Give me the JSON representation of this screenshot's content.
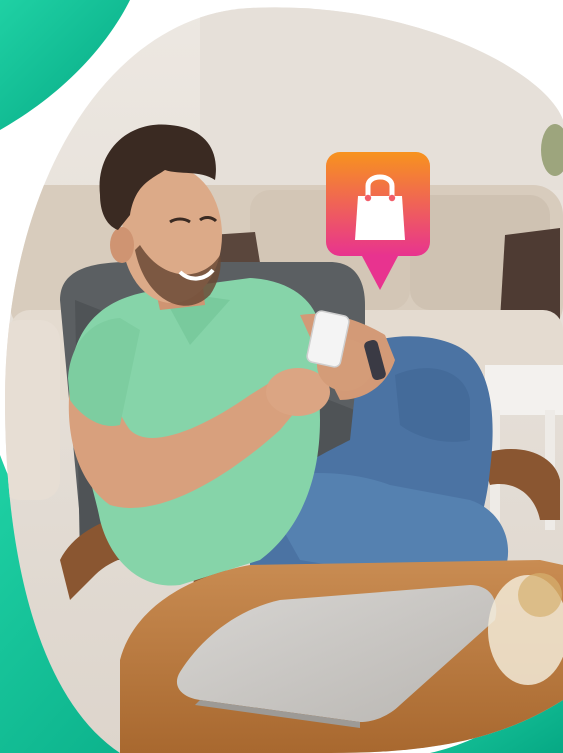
{
  "scene": {
    "subject": "man-with-smartphone",
    "icons": [
      "shopping-bag-icon"
    ],
    "colors": {
      "accent_teal": "#12c79a",
      "accent_teal_dark": "#0aa887",
      "badge_orange": "#f7931e",
      "badge_pink": "#e8338f",
      "shirt": "#86d4a9",
      "jeans": "#4d77a6",
      "wall": "#e9e3dd",
      "sofa": "#d9cdbf",
      "wood": "#b8773f"
    }
  }
}
